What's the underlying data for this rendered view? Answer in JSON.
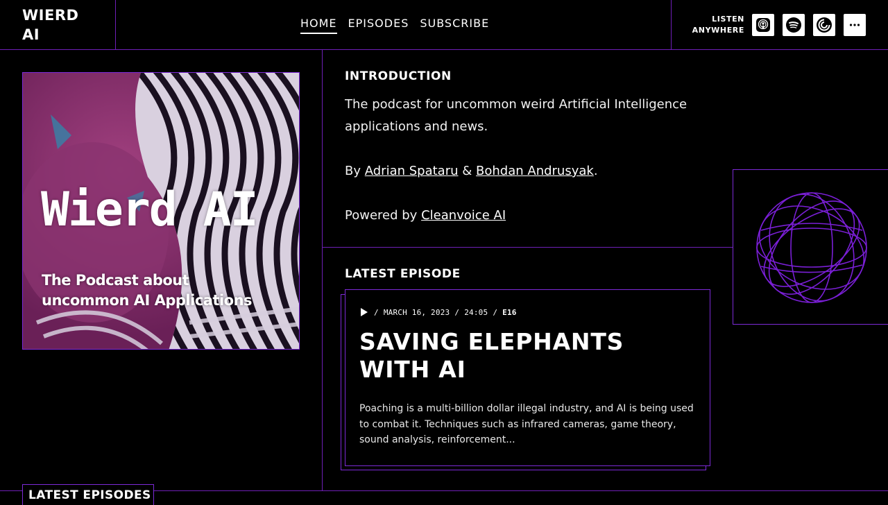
{
  "header": {
    "logo": "WIERD AI",
    "nav": [
      {
        "label": "HOME",
        "active": true
      },
      {
        "label": "EPISODES",
        "active": false
      },
      {
        "label": "SUBSCRIBE",
        "active": false
      }
    ],
    "listen_line1": "LISTEN",
    "listen_line2": "ANYWHERE",
    "platform_icons": [
      "apple-podcasts-icon",
      "spotify-icon",
      "pocket-casts-icon",
      "more-icon"
    ]
  },
  "cover": {
    "title": "Wierd AI",
    "subtitle": "The Podcast about uncommon AI Applications"
  },
  "intro": {
    "heading": "INTRODUCTION",
    "description": "The podcast for uncommon weird Artificial Intelligence applications and news.",
    "by_prefix": "By",
    "author1": "Adrian Spataru",
    "amp": "&",
    "author2": "Bohdan Andrusyak",
    "period": ".",
    "powered_prefix": "Powered by",
    "powered_link": "Cleanvoice AI"
  },
  "latest": {
    "heading": "LATEST EPISODE",
    "date": "MARCH 16, 2023",
    "duration": "24:05",
    "episode": "E16",
    "separator": "/",
    "title": "SAVING ELEPHANTS WITH AI",
    "description": "Poaching is a multi-billion dollar illegal industry, and AI is being used to combat it. Techniques such as infrared cameras, game theory, sound analysis, reinforcement..."
  },
  "episodes": {
    "heading": "LATEST EPISODES"
  },
  "colors": {
    "accent": "#6f1fb8",
    "background": "#000000",
    "cover_magenta": "#7a2a63"
  }
}
